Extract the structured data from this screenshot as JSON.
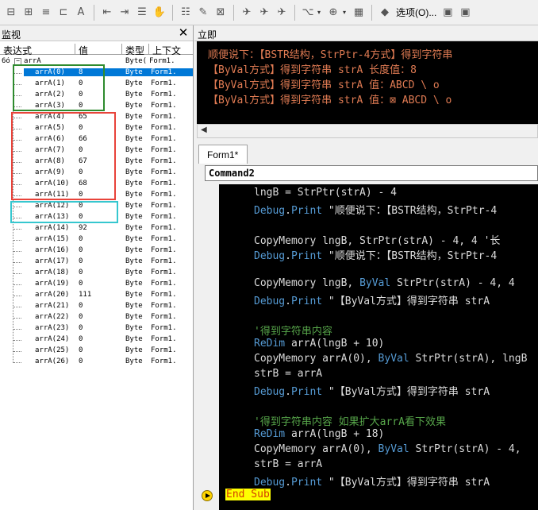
{
  "toolbar": {
    "options_label": "选项(O)...",
    "icons": [
      "ruler-icon",
      "format-icon",
      "align-left-icon",
      "align-center-icon",
      "font-size-icon",
      "indent-icon",
      "outdent-icon",
      "bullets-icon",
      "hand-icon",
      "numbers-icon",
      "text-icon",
      "bookmark-icon",
      "next-bookmark-icon",
      "prev-bookmark-icon",
      "clear-bookmarks-icon",
      "run-icon",
      "break-icon",
      "panel-icon",
      "diamond-icon",
      "window-icon",
      "window2-icon"
    ]
  },
  "watch": {
    "title": "监视",
    "columns": {
      "expr": "表达式",
      "value": "值",
      "type": "类型",
      "context": "上下文"
    },
    "root": {
      "glyph": "6ó",
      "name": "arrA",
      "type": "Byte(",
      "context": "Form1."
    },
    "rows": [
      {
        "expr": "arrA(0)",
        "value": "8",
        "type": "Byte",
        "context": "Form1."
      },
      {
        "expr": "arrA(1)",
        "value": "0",
        "type": "Byte",
        "context": "Form1."
      },
      {
        "expr": "arrA(2)",
        "value": "0",
        "type": "Byte",
        "context": "Form1."
      },
      {
        "expr": "arrA(3)",
        "value": "0",
        "type": "Byte",
        "context": "Form1."
      },
      {
        "expr": "arrA(4)",
        "value": "65",
        "type": "Byte",
        "context": "Form1."
      },
      {
        "expr": "arrA(5)",
        "value": "0",
        "type": "Byte",
        "context": "Form1."
      },
      {
        "expr": "arrA(6)",
        "value": "66",
        "type": "Byte",
        "context": "Form1."
      },
      {
        "expr": "arrA(7)",
        "value": "0",
        "type": "Byte",
        "context": "Form1."
      },
      {
        "expr": "arrA(8)",
        "value": "67",
        "type": "Byte",
        "context": "Form1."
      },
      {
        "expr": "arrA(9)",
        "value": "0",
        "type": "Byte",
        "context": "Form1."
      },
      {
        "expr": "arrA(10)",
        "value": "68",
        "type": "Byte",
        "context": "Form1."
      },
      {
        "expr": "arrA(11)",
        "value": "0",
        "type": "Byte",
        "context": "Form1."
      },
      {
        "expr": "arrA(12)",
        "value": "0",
        "type": "Byte",
        "context": "Form1."
      },
      {
        "expr": "arrA(13)",
        "value": "0",
        "type": "Byte",
        "context": "Form1."
      },
      {
        "expr": "arrA(14)",
        "value": "92",
        "type": "Byte",
        "context": "Form1."
      },
      {
        "expr": "arrA(15)",
        "value": "0",
        "type": "Byte",
        "context": "Form1."
      },
      {
        "expr": "arrA(16)",
        "value": "0",
        "type": "Byte",
        "context": "Form1."
      },
      {
        "expr": "arrA(17)",
        "value": "0",
        "type": "Byte",
        "context": "Form1."
      },
      {
        "expr": "arrA(18)",
        "value": "0",
        "type": "Byte",
        "context": "Form1."
      },
      {
        "expr": "arrA(19)",
        "value": "0",
        "type": "Byte",
        "context": "Form1."
      },
      {
        "expr": "arrA(20)",
        "value": "111",
        "type": "Byte",
        "context": "Form1."
      },
      {
        "expr": "arrA(21)",
        "value": "0",
        "type": "Byte",
        "context": "Form1."
      },
      {
        "expr": "arrA(22)",
        "value": "0",
        "type": "Byte",
        "context": "Form1."
      },
      {
        "expr": "arrA(23)",
        "value": "0",
        "type": "Byte",
        "context": "Form1."
      },
      {
        "expr": "arrA(24)",
        "value": "0",
        "type": "Byte",
        "context": "Form1."
      },
      {
        "expr": "arrA(25)",
        "value": "0",
        "type": "Byte",
        "context": "Form1."
      },
      {
        "expr": "arrA(26)",
        "value": "0",
        "type": "Byte",
        "context": "Form1."
      }
    ],
    "highlight_colors": {
      "green": "#2e8b2e",
      "red": "#e8433a",
      "cyan": "#36c7cf"
    }
  },
  "immediate": {
    "title": "立即",
    "lines": [
      "顺便说下：【BSTR结构，StrPtr-4方式】得到字符串",
      "【ByVal方式】得到字符串 strA 长度值：8",
      "【ByVal方式】得到字符串 strA 值：ABCD \\  o",
      "【ByVal方式】得到字符串 strA 值：⊠ ABCD \\  o"
    ],
    "text_color": "#e07b53"
  },
  "code_window": {
    "tab_label": "Form1*",
    "object_combo": "Command2",
    "end_sub_text": "End Sub",
    "lines": [
      [
        {
          "t": "lngB = StrPtr(strA) - 4",
          "c": "n"
        }
      ],
      [
        {
          "t": "Debug",
          "c": "k"
        },
        {
          "t": ".",
          "c": "n"
        },
        {
          "t": "Print",
          "c": "k"
        },
        {
          "t": " \"顺便说下：【BSTR结构，StrPtr-4",
          "c": "n"
        }
      ],
      [],
      [
        {
          "t": "CopyMemory lngB, StrPtr(strA) - 4, 4  '长",
          "c": "n"
        }
      ],
      [
        {
          "t": "Debug",
          "c": "k"
        },
        {
          "t": ".",
          "c": "n"
        },
        {
          "t": "Print",
          "c": "k"
        },
        {
          "t": " \"顺便说下：【BSTR结构，StrPtr-4",
          "c": "n"
        }
      ],
      [],
      [
        {
          "t": "CopyMemory lngB, ",
          "c": "n"
        },
        {
          "t": "ByVal",
          "c": "k"
        },
        {
          "t": " StrPtr(strA) - 4, 4",
          "c": "n"
        }
      ],
      [
        {
          "t": "Debug",
          "c": "k"
        },
        {
          "t": ".",
          "c": "n"
        },
        {
          "t": "Print",
          "c": "k"
        },
        {
          "t": " \"【ByVal方式】得到字符串 strA",
          "c": "n"
        }
      ],
      [],
      [
        {
          "t": "'得到字符串内容",
          "c": "c"
        }
      ],
      [
        {
          "t": "ReDim",
          "c": "k"
        },
        {
          "t": " arrA(lngB + 10)",
          "c": "n"
        }
      ],
      [
        {
          "t": "CopyMemory arrA(0), ",
          "c": "n"
        },
        {
          "t": "ByVal",
          "c": "k"
        },
        {
          "t": " StrPtr(strA), lngB",
          "c": "n"
        }
      ],
      [
        {
          "t": "strB = arrA",
          "c": "n"
        }
      ],
      [
        {
          "t": "Debug",
          "c": "k"
        },
        {
          "t": ".",
          "c": "n"
        },
        {
          "t": "Print",
          "c": "k"
        },
        {
          "t": " \"【ByVal方式】得到字符串 strA",
          "c": "n"
        }
      ],
      [],
      [
        {
          "t": "'得到字符串内容 如果扩大arrA看下效果",
          "c": "c"
        }
      ],
      [
        {
          "t": "ReDim",
          "c": "k"
        },
        {
          "t": " arrA(lngB + 18)",
          "c": "n"
        }
      ],
      [
        {
          "t": "CopyMemory arrA(0), ",
          "c": "n"
        },
        {
          "t": "ByVal",
          "c": "k"
        },
        {
          "t": " StrPtr(strA) - 4,",
          "c": "n"
        }
      ],
      [
        {
          "t": "strB = arrA",
          "c": "n"
        }
      ],
      [
        {
          "t": "Debug",
          "c": "k"
        },
        {
          "t": ".",
          "c": "n"
        },
        {
          "t": "Print",
          "c": "k"
        },
        {
          "t": " \"【ByVal方式】得到字符串 strA",
          "c": "n"
        }
      ]
    ]
  }
}
